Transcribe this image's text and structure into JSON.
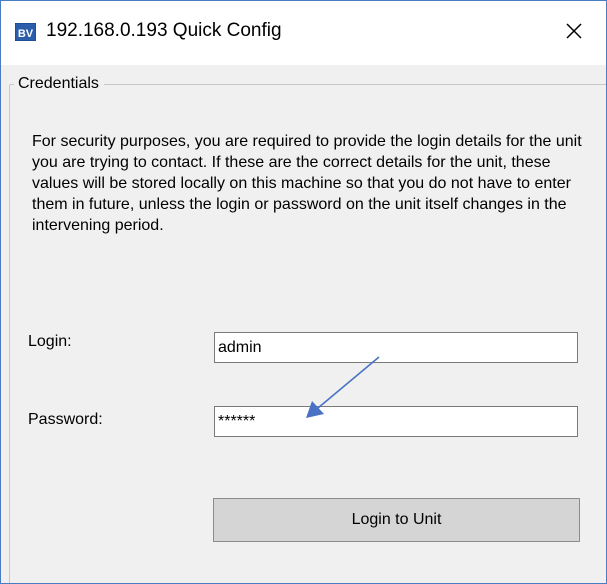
{
  "window": {
    "title": "192.168.0.193 Quick Config",
    "app_icon": "bv-app-icon",
    "app_icon_text": "BV",
    "close_icon": "close-icon"
  },
  "credentials": {
    "legend": "Credentials",
    "description": "For security purposes, you are required to provide the login details for the unit you are trying to contact. If these are the correct details for the unit, these values will be stored locally on this machine so that you do not have to enter them in future, unless the login or password on the unit itself changes in the intervening period.",
    "login_label": "Login:",
    "login_value": "admin",
    "password_label": "Password:",
    "password_value": "******",
    "login_button": "Login to Unit"
  },
  "annotation": {
    "arrow_color": "#4a72c4",
    "arrow_icon": "annotation-arrow-icon"
  }
}
